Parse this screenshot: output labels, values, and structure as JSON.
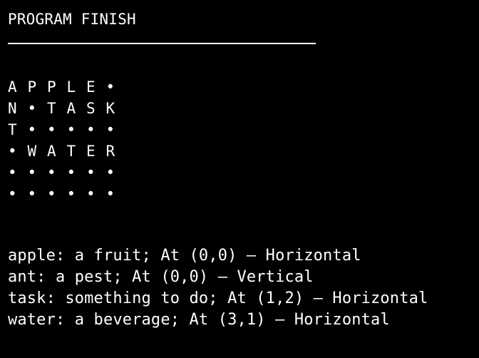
{
  "title": "PROGRAM FINISH",
  "grid": [
    [
      "A",
      "P",
      "P",
      "L",
      "E",
      "•"
    ],
    [
      "N",
      "•",
      "T",
      "A",
      "S",
      "K"
    ],
    [
      "T",
      "•",
      "•",
      "•",
      "•",
      "•"
    ],
    [
      "•",
      "W",
      "A",
      "T",
      "E",
      "R"
    ],
    [
      "•",
      "•",
      "•",
      "•",
      "•",
      "•"
    ],
    [
      "•",
      "•",
      "•",
      "•",
      "•",
      "•"
    ]
  ],
  "clues": [
    "apple: a fruit; At (0,0) — Horizontal",
    "ant: a pest; At (0,0) — Vertical",
    "task: something to do; At (1,2) — Horizontal",
    "water: a beverage; At (3,1) — Horizontal"
  ],
  "colors": {
    "background": "#000000",
    "text": "#ffffff"
  }
}
